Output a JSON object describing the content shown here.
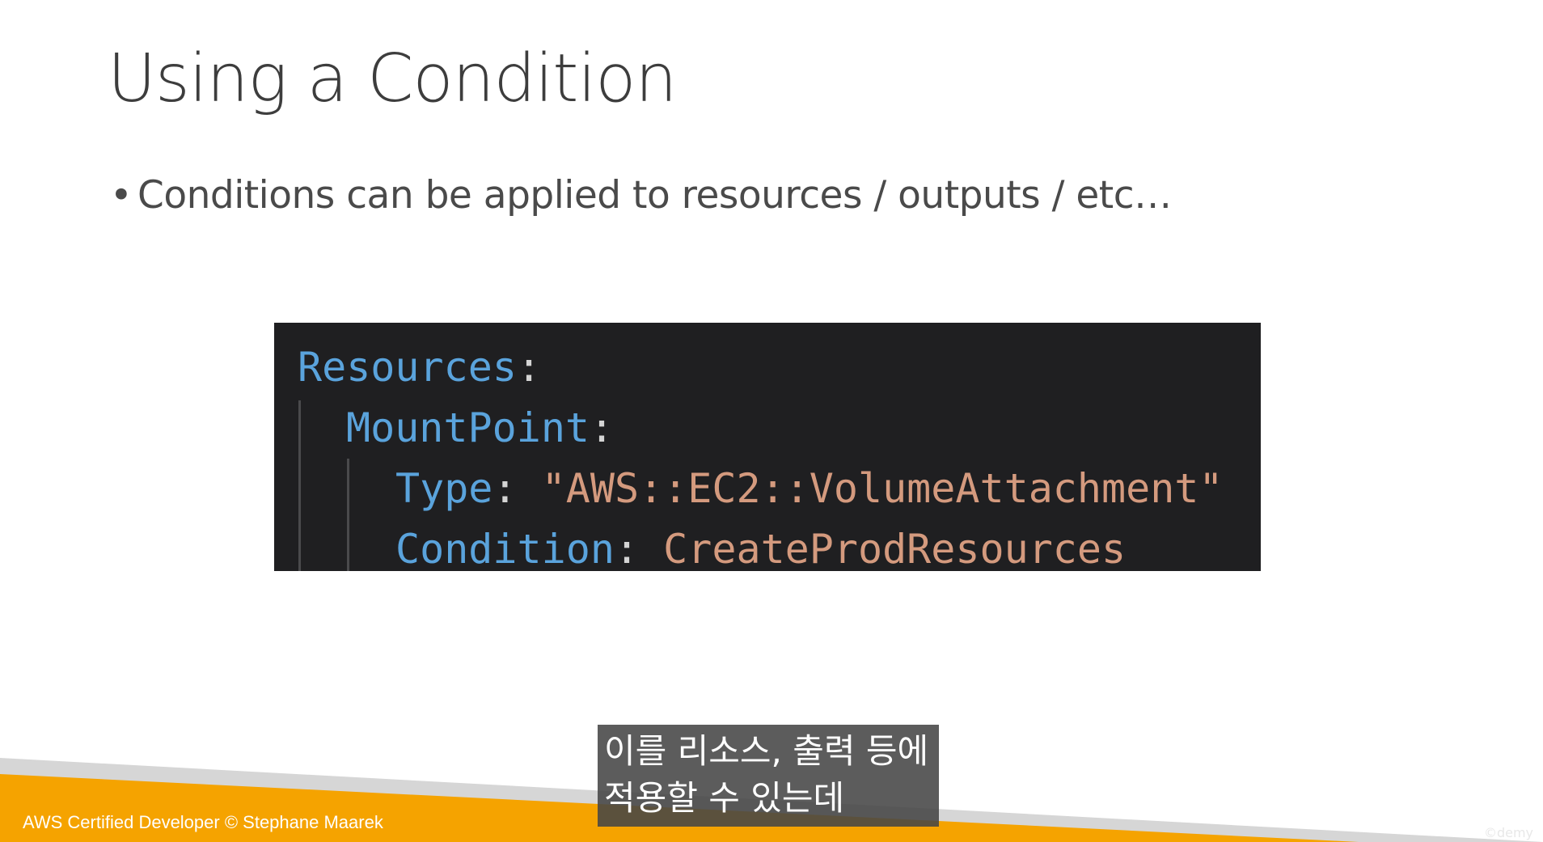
{
  "slide": {
    "title": "Using a Condition",
    "bullet_marker": "•",
    "bullet_text": "Conditions can be applied to resources / outputs / etc…"
  },
  "code": {
    "line1_key": "Resources",
    "line2_key": "MountPoint",
    "line3_key": "Type",
    "line3_value": "\"AWS::EC2::VolumeAttachment\"",
    "line4_key": "Condition",
    "line4_value": "CreateProdResources",
    "colon": ":"
  },
  "footer": {
    "credit": "AWS Certified Developer © Stephane Maarek"
  },
  "subtitles": {
    "line1": "이를 리소스, 출력 등에",
    "line2": "적용할 수 있는데"
  },
  "watermark": {
    "text": "©demy"
  },
  "colors": {
    "accent_orange": "#f5a300",
    "code_background": "#1f1f21",
    "code_key": "#5aa3dc",
    "code_string": "#d49a7e"
  }
}
